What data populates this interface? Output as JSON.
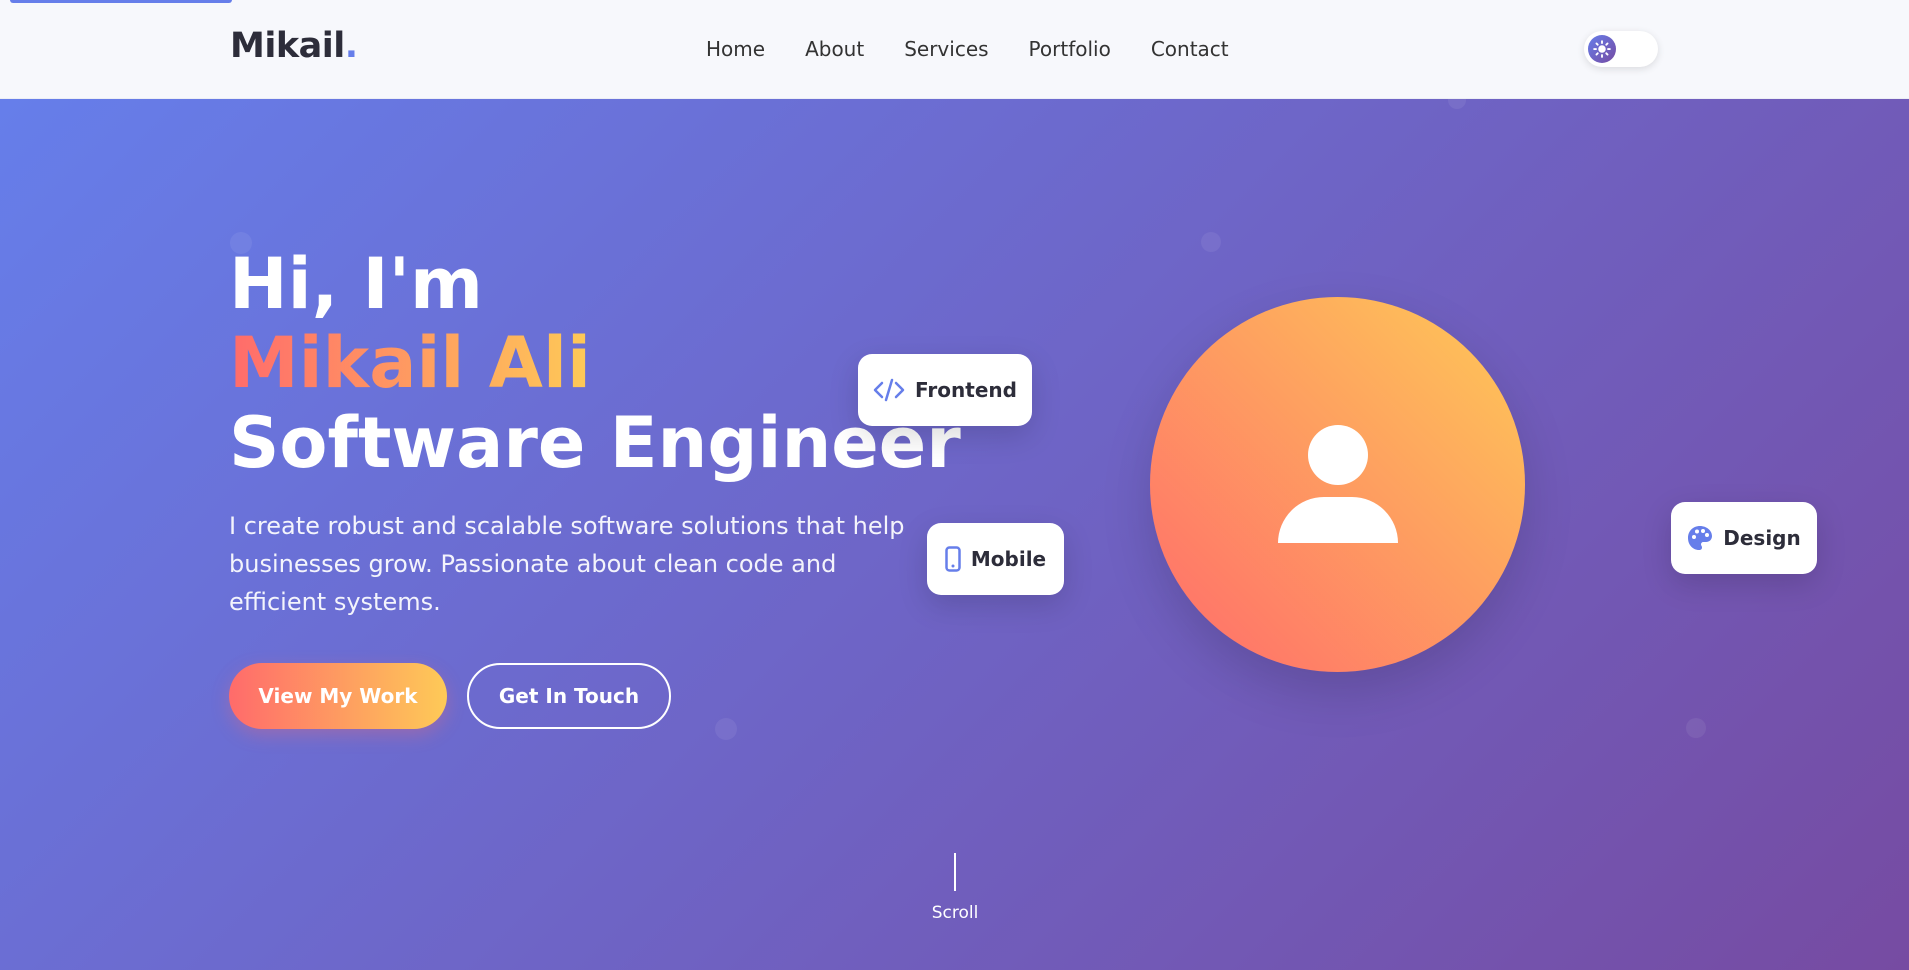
{
  "brand": {
    "name": "Mikail",
    "dot": "."
  },
  "nav": {
    "links": [
      {
        "label": "Home"
      },
      {
        "label": "About"
      },
      {
        "label": "Services"
      },
      {
        "label": "Portfolio"
      },
      {
        "label": "Contact"
      }
    ],
    "theme_toggle_icon": "sun-icon"
  },
  "hero": {
    "greeting": "Hi, I'm",
    "name": "Mikail Ali",
    "role": "Software Engineer",
    "description": "I create robust and scalable software solutions that help businesses grow. Passionate about clean code and efficient systems.",
    "primary_button": "View My Work",
    "secondary_button": "Get In Touch",
    "avatar_icon": "user-icon",
    "cards": [
      {
        "label": "Frontend",
        "icon": "code-icon"
      },
      {
        "label": "Mobile",
        "icon": "mobile-icon"
      },
      {
        "label": "Design",
        "icon": "palette-icon"
      }
    ],
    "scroll_label": "Scroll"
  },
  "colors": {
    "accent": "#667eea",
    "gradient_start": "#667eea",
    "gradient_end": "#764ba2",
    "highlight_start": "#ff6b6b",
    "highlight_end": "#feca57"
  }
}
